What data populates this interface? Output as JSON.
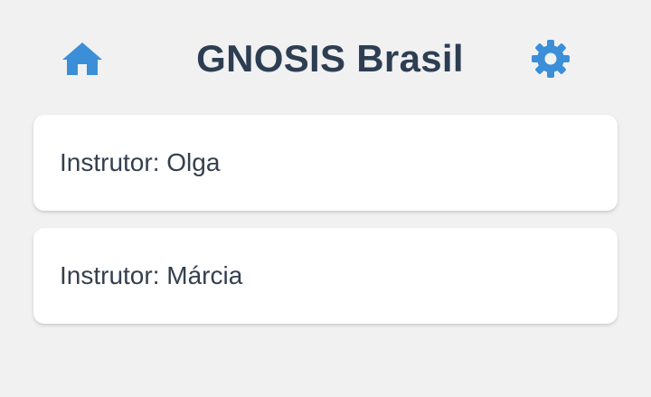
{
  "header": {
    "title": "GNOSIS Brasil",
    "home_icon": "home-icon",
    "settings_icon": "gear-icon"
  },
  "instructors": [
    {
      "label": "Instrutor: Olga"
    },
    {
      "label": "Instrutor: Márcia"
    }
  ],
  "colors": {
    "accent": "#3a8fd8",
    "title": "#2e3e52",
    "background": "#f1f1f2",
    "card": "#ffffff"
  }
}
